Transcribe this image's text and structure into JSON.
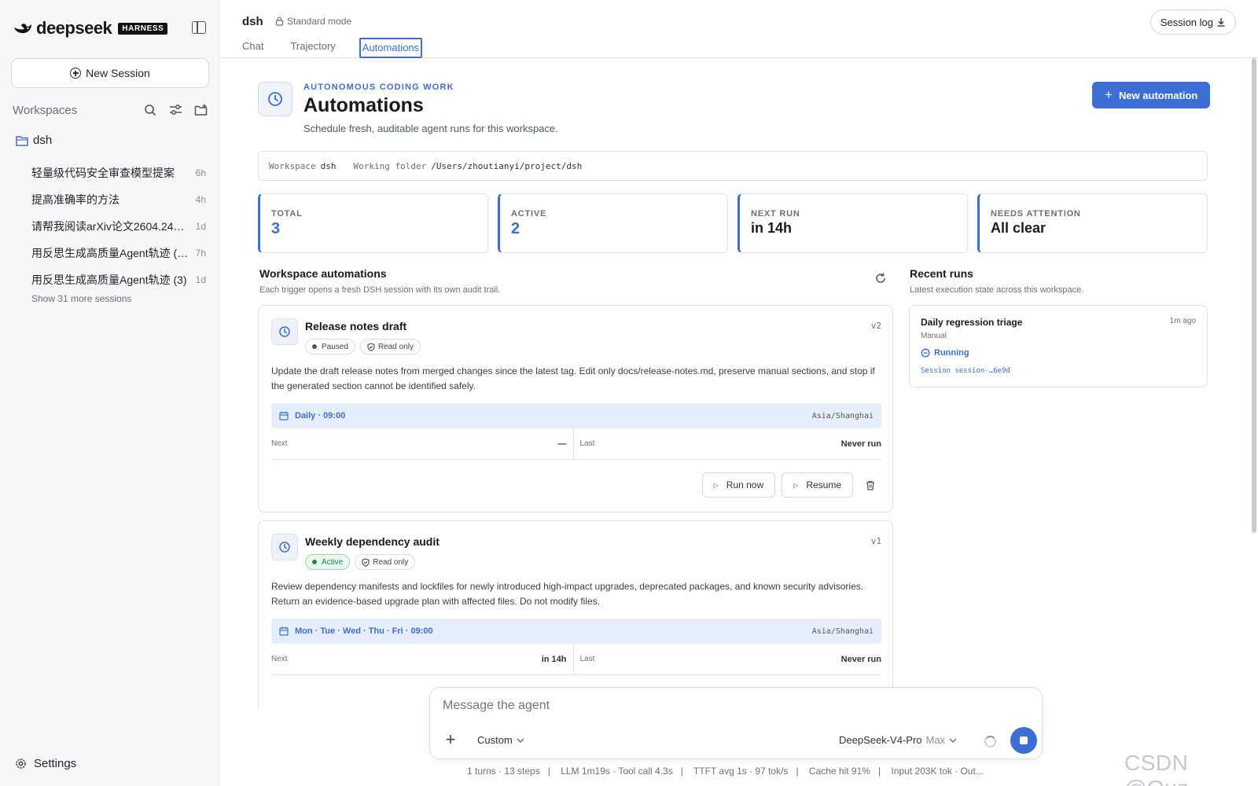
{
  "brand": {
    "name": "deepseek",
    "badge": "HARNESS"
  },
  "sidebar": {
    "new_session_label": "New Session",
    "workspaces_label": "Workspaces",
    "folder_name": "dsh",
    "sessions": [
      {
        "title": "轻量级代码安全审查模型提案",
        "age": "6h"
      },
      {
        "title": "提高准确率的方法",
        "age": "4h"
      },
      {
        "title": "请帮我阅读arXiv论文2604.24…",
        "age": "1d"
      },
      {
        "title": "用反思生成高质量Agent轨迹 (…",
        "age": "7h"
      },
      {
        "title": "用反思生成高质量Agent轨迹 (3)",
        "age": "1d"
      }
    ],
    "show_more_label": "Show 31 more sessions",
    "settings_label": "Settings"
  },
  "header": {
    "title": "dsh",
    "mode": "Standard mode",
    "tabs": [
      {
        "label": "Chat"
      },
      {
        "label": "Trajectory"
      },
      {
        "label": "Automations"
      }
    ],
    "session_log_label": "Session log"
  },
  "hero": {
    "eyebrow": "AUTONOMOUS CODING WORK",
    "title": "Automations",
    "subtitle": "Schedule fresh, auditable agent runs for this workspace.",
    "new_button": "New automation"
  },
  "workspace_bar": {
    "workspace_key": "Workspace",
    "workspace_value": "dsh",
    "folder_key": "Working folder",
    "folder_value": "/Users/zhoutianyi/project/dsh"
  },
  "stats": [
    {
      "label": "TOTAL",
      "value": "3"
    },
    {
      "label": "ACTIVE",
      "value": "2"
    },
    {
      "label": "NEXT RUN",
      "value": "in 14h"
    },
    {
      "label": "NEEDS ATTENTION",
      "value": "All clear"
    }
  ],
  "automations_section": {
    "title": "Workspace automations",
    "subtitle": "Each trigger opens a fresh DSH session with its own audit trail."
  },
  "automations": [
    {
      "title": "Release notes draft",
      "version": "v2",
      "status": "Paused",
      "permission": "Read only",
      "description": "Update the draft release notes from merged changes since the latest tag. Edit only docs/release-notes.md, preserve manual sections, and stop if the generated section cannot be identified safely.",
      "schedule": "Daily · 09:00",
      "timezone": "Asia/Shanghai",
      "next_label": "Next",
      "next_value": "—",
      "last_label": "Last",
      "last_value": "Never run",
      "run_now_label": "Run now",
      "resume_label": "Resume"
    },
    {
      "title": "Weekly dependency audit",
      "version": "v1",
      "status": "Active",
      "permission": "Read only",
      "description": "Review dependency manifests and lockfiles for newly introduced high-impact upgrades, deprecated packages, and known security advisories. Return an evidence-based upgrade plan with affected files. Do not modify files.",
      "schedule": "Mon · Tue · Wed · Thu · Fri · 09:00",
      "timezone": "Asia/Shanghai",
      "next_label": "Next",
      "next_value": "in 14h",
      "last_label": "Last",
      "last_value": "Never run"
    }
  ],
  "recent_runs": {
    "title": "Recent runs",
    "subtitle": "Latest execution state across this workspace.",
    "items": [
      {
        "title": "Daily regression triage",
        "time": "1m ago",
        "trigger": "Manual",
        "status": "Running",
        "session": "Session session-…6e9d"
      }
    ]
  },
  "composer": {
    "placeholder": "Message the agent",
    "mode": "Custom",
    "model": "DeepSeek-V4-Pro",
    "effort": "Max"
  },
  "status_bar": {
    "turns": "1 turns · 13 steps",
    "llm": "LLM 1m19s · Tool call 4.3s",
    "ttft": "TTFT avg 1s · 97 tok/s",
    "cache": "Cache hit 91%",
    "tokens": "Input 203K tok · Out..."
  },
  "watermark": "CSDN @Quz",
  "colors": {
    "accent": "#3b6fd6",
    "active_green": "#1d8b45"
  }
}
